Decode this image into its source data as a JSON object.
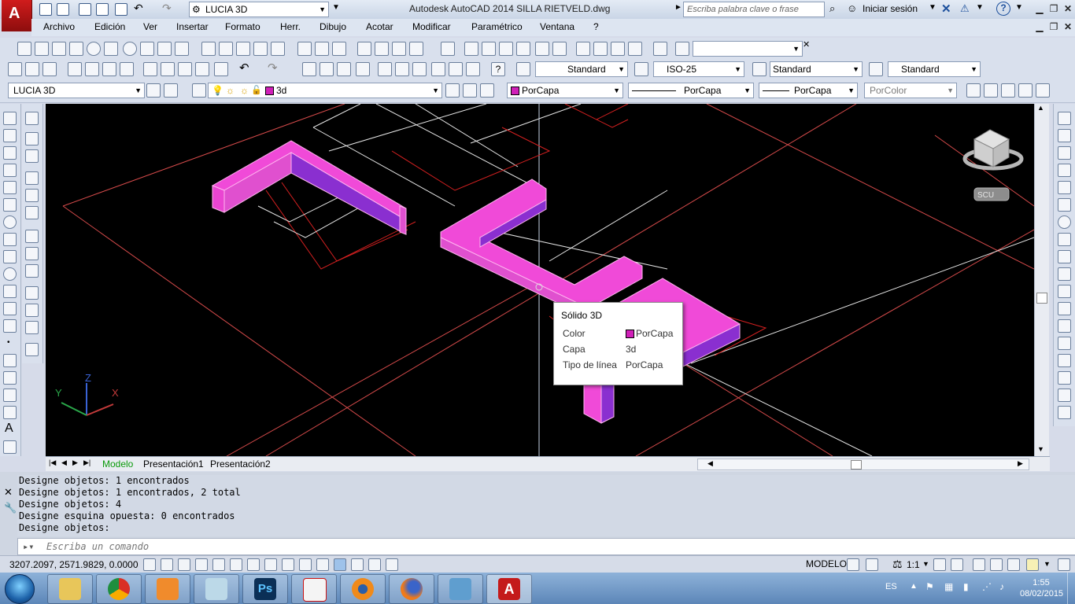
{
  "titlebar": {
    "workspace": "LUCIA 3D",
    "title": "Autodesk AutoCAD 2014    SILLA RIETVELD.dwg",
    "search_placeholder": "Escriba palabra clave o frase",
    "signin": "Iniciar sesión",
    "help": "?"
  },
  "menu": [
    "Archivo",
    "Edición",
    "Ver",
    "Insertar",
    "Formato",
    "Herr.",
    "Dibujo",
    "Acotar",
    "Modificar",
    "Paramétrico",
    "Ventana",
    "?"
  ],
  "toolbar2": {
    "text_style": "Standard",
    "dim_style": "ISO-25",
    "table_style": "Standard",
    "mleader_style": "Standard"
  },
  "toolbar3": {
    "workspace": "LUCIA 3D",
    "layer": "3d",
    "color": "PorCapa",
    "linetype": "PorCapa",
    "lineweight": "PorCapa",
    "plotstyle": "PorColor"
  },
  "viewcube": {
    "scu_label": "SCU"
  },
  "ucs": {
    "x": "X",
    "y": "Y",
    "z": "Z"
  },
  "tooltip": {
    "title": "Sólido 3D",
    "rows": [
      {
        "key": "Color",
        "value": "PorCapa"
      },
      {
        "key": "Capa",
        "value": "3d"
      },
      {
        "key": "Tipo de línea",
        "value": "PorCapa"
      }
    ]
  },
  "tabs": [
    "Modelo",
    "Presentación1",
    "Presentación2"
  ],
  "command": {
    "history": [
      "Designe objetos: 1 encontrados",
      "Designe objetos: 1 encontrados, 2 total",
      "Designe objetos: 4",
      "Designe esquina opuesta: 0 encontrados",
      "Designe objetos:"
    ],
    "placeholder": "Escriba un comando"
  },
  "status": {
    "coords": "3207.2097, 2571.9829, 0.0000",
    "model": "MODELO",
    "scale": "1:1"
  },
  "taskbar": {
    "lang": "ES",
    "time": "1:55",
    "date": "08/02/2015"
  },
  "colors": {
    "solid_top": "#f04ad8",
    "solid_side": "#8a2fd0",
    "red_lines": "#d42020",
    "white_lines": "#e8e8e8"
  }
}
